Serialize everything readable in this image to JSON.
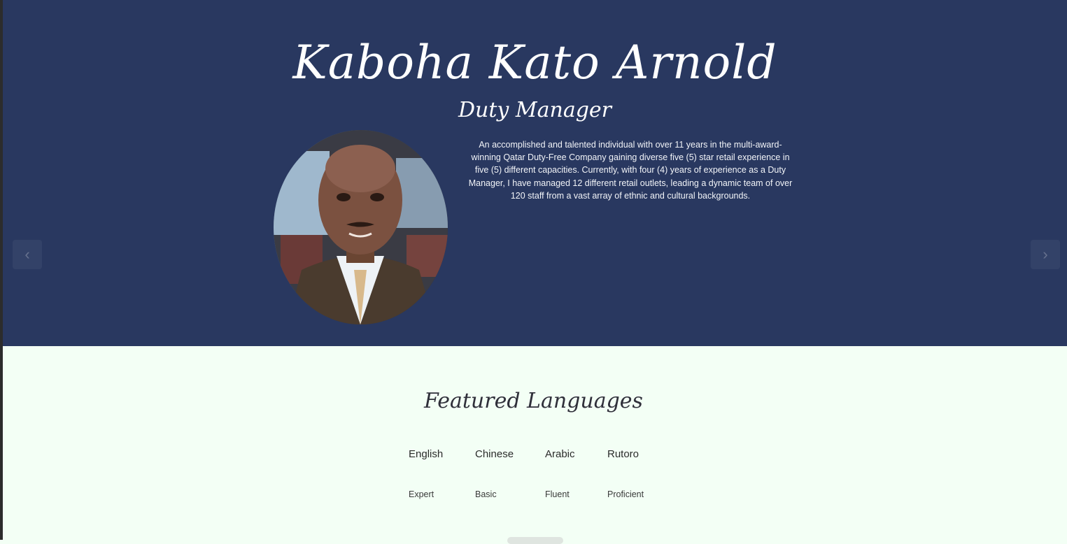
{
  "hero": {
    "name": "Kaboha Kato Arnold",
    "role": "Duty Manager",
    "bio": "An accomplished and talented individual with over 11 years in the multi-award-winning Qatar Duty-Free Company gaining diverse five (5) star retail experience in five (5) different capacities. Currently, with four (4) years of experience as a Duty Manager, I have managed 12 different retail outlets, leading a dynamic team of over 120 staff from a vast array of ethnic and cultural backgrounds.",
    "prev_icon": "chevron-left-icon",
    "next_icon": "chevron-right-icon",
    "prev_glyph": "‹",
    "next_glyph": "›"
  },
  "languages": {
    "title": "Featured Languages",
    "items": [
      {
        "name": "English",
        "level": "Expert"
      },
      {
        "name": "Chinese",
        "level": "Basic"
      },
      {
        "name": "Arabic",
        "level": "Fluent"
      },
      {
        "name": "Rutoro",
        "level": "Proficient"
      }
    ]
  },
  "colors": {
    "hero_bg": "#293860",
    "page_bg": "#f3fff5",
    "text_dark": "#2b2b2b"
  }
}
